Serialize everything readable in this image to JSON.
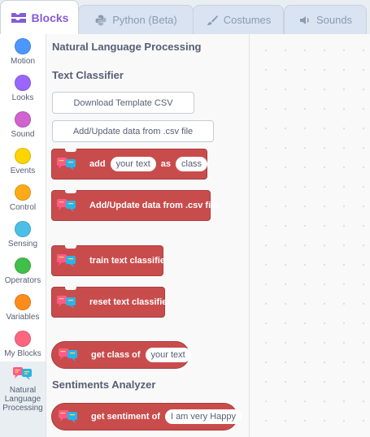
{
  "tabs": [
    {
      "label": "Blocks",
      "icon": "blocks-icon"
    },
    {
      "label": "Python (Beta)",
      "icon": "python-icon"
    },
    {
      "label": "Costumes",
      "icon": "brush-icon"
    },
    {
      "label": "Sounds",
      "icon": "speaker-icon"
    }
  ],
  "categories": [
    {
      "label": "Motion",
      "color": "#4c97ff"
    },
    {
      "label": "Looks",
      "color": "#9966ff"
    },
    {
      "label": "Sound",
      "color": "#cf63cf"
    },
    {
      "label": "Events",
      "color": "#ffd500"
    },
    {
      "label": "Control",
      "color": "#ffab19"
    },
    {
      "label": "Sensing",
      "color": "#4cbfe6"
    },
    {
      "label": "Operators",
      "color": "#40bf4a"
    },
    {
      "label": "Variables",
      "color": "#ff8c1a"
    },
    {
      "label": "My Blocks",
      "color": "#ff6680"
    },
    {
      "label": "Natural Language Processing",
      "icon": "nlp-icon"
    }
  ],
  "palette": {
    "title": "Natural Language Processing",
    "section_text_classifier": "Text Classifier",
    "download_button": "Download Template CSV",
    "add_update_button": "Add/Update data from .csv file",
    "blocks": {
      "add": {
        "pre": "add",
        "arg1": "your text",
        "mid": "as",
        "arg2": "class"
      },
      "add_update": "Add/Update data from .csv file",
      "train": "train text classifier",
      "reset": "reset text classifier",
      "get_class": {
        "pre": "get class of",
        "arg": "your text"
      }
    },
    "section_sentiments": "Sentiments Analyzer",
    "sentiment": {
      "pre": "get sentiment of",
      "arg": "I am very Happy"
    }
  },
  "colors": {
    "accent": "#855cd6",
    "nlp_block": "#c94c4c"
  }
}
